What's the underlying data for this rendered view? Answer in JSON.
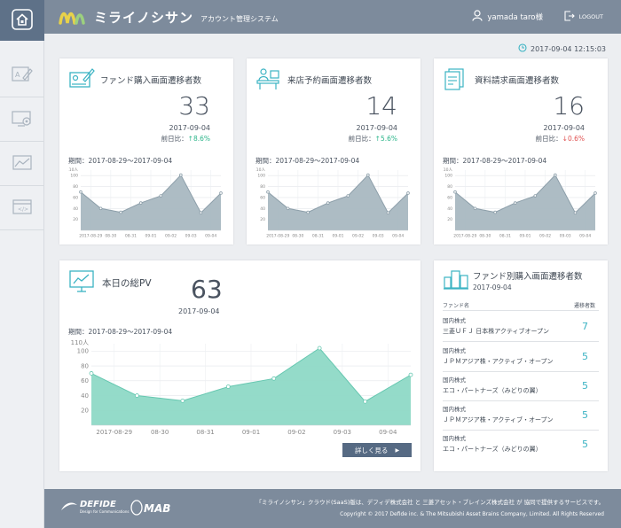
{
  "app": {
    "name": "ミライノシサン",
    "subtitle": "アカウント管理システム"
  },
  "header": {
    "user": "yamada taro様",
    "logout": "LOGOUT"
  },
  "timestamp": "2017-09-04 12:15:03",
  "sidebar": {
    "items": [
      "home-icon",
      "document-edit-icon",
      "monitor-gear-icon",
      "line-chart-icon",
      "web-code-icon"
    ]
  },
  "cards": [
    {
      "title": "ファンド購入画面遷移者数",
      "value": "33",
      "date": "2017-09-04",
      "cmp_label": "前日比：",
      "cmp_value": "↑8.6%",
      "cmp_dir": "up",
      "period": "期間：2017-08-29〜2017-09-04"
    },
    {
      "title": "来店予約画面遷移者数",
      "value": "14",
      "date": "2017-09-04",
      "cmp_label": "前日比：",
      "cmp_value": "↑5.6%",
      "cmp_dir": "up",
      "period": "期間：2017-08-29〜2017-09-04"
    },
    {
      "title": "資料請求画面遷移者数",
      "value": "16",
      "date": "2017-09-04",
      "cmp_label": "前日比：",
      "cmp_value": "↓0.6%",
      "cmp_dir": "down",
      "period": "期間：2017-08-29〜2017-09-04"
    }
  ],
  "pv": {
    "title": "本日の総PV",
    "value": "63",
    "date": "2017-09-04",
    "period": "期間：2017-08-29〜2017-09-04",
    "button": "詳しく見る"
  },
  "fund_table": {
    "title": "ファンド別購入画面遷移者数",
    "date": "2017-09-04",
    "col_name": "ファンド名",
    "col_count": "遷移者数",
    "rows": [
      {
        "kind": "国内株式",
        "name": "三菱ＵＦＪ 日本株アクティブオープン",
        "count": "7"
      },
      {
        "kind": "国内株式",
        "name": "ＪＰＭアジア株・アクティブ・オープン",
        "count": "5"
      },
      {
        "kind": "国内株式",
        "name": "エコ・パートナーズ（みどりの翼）",
        "count": "5"
      },
      {
        "kind": "国内株式",
        "name": "ＪＰＭアジア株・アクティブ・オープン",
        "count": "5"
      },
      {
        "kind": "国内株式",
        "name": "エコ・パートナーズ（みどりの翼）",
        "count": "5"
      }
    ]
  },
  "footer": {
    "brand1": "DEFIDE",
    "brand1_sub": "Design for Communications",
    "brand2": "MAB",
    "line1": "「ミライノシサン」クラウド(SaaS)版は、デフィデ株式会社 と 三菱アセット・ブレインズ株式会社 が 協同で提供するサービスです。",
    "line2": "Copyright © 2017 Defide inc. & The Mitsubishi Asset Brains Company, Limited. All Rights Reserved"
  },
  "colors": {
    "header": "#7d8b9c",
    "mini_fill": "#a9b8c1",
    "pv_fill": "#8ed9c6",
    "accent": "#3bb3c3"
  },
  "chart_data": [
    {
      "type": "area",
      "unit": "110人",
      "x": [
        "2017-08-29",
        "08-30",
        "08-31",
        "09-01",
        "09-02",
        "09-03",
        "09-04"
      ],
      "ticks": [
        20,
        40,
        60,
        80,
        100
      ],
      "ylim": [
        0,
        110
      ],
      "values": [
        70,
        40,
        33,
        50,
        63,
        101,
        32,
        68
      ]
    },
    {
      "type": "area",
      "unit": "110人",
      "x": [
        "2017-08-29",
        "08-30",
        "08-31",
        "09-01",
        "09-02",
        "09-03",
        "09-04"
      ],
      "ticks": [
        20,
        40,
        60,
        80,
        100
      ],
      "ylim": [
        0,
        110
      ],
      "values": [
        70,
        40,
        33,
        50,
        63,
        101,
        32,
        68
      ]
    },
    {
      "type": "area",
      "unit": "110人",
      "x": [
        "2017-08-29",
        "08-30",
        "08-31",
        "09-01",
        "09-02",
        "09-03",
        "09-04"
      ],
      "ticks": [
        20,
        40,
        60,
        80,
        100
      ],
      "ylim": [
        0,
        110
      ],
      "values": [
        70,
        40,
        33,
        50,
        63,
        101,
        32,
        68
      ]
    },
    {
      "type": "area",
      "unit": "110人",
      "x": [
        "2017-08-29",
        "08-30",
        "08-31",
        "09-01",
        "09-02",
        "09-03",
        "09-04"
      ],
      "ticks": [
        20,
        40,
        60,
        80,
        100
      ],
      "ylim": [
        0,
        110
      ],
      "values": [
        70,
        40,
        33,
        52,
        63,
        104,
        32,
        68
      ]
    }
  ]
}
